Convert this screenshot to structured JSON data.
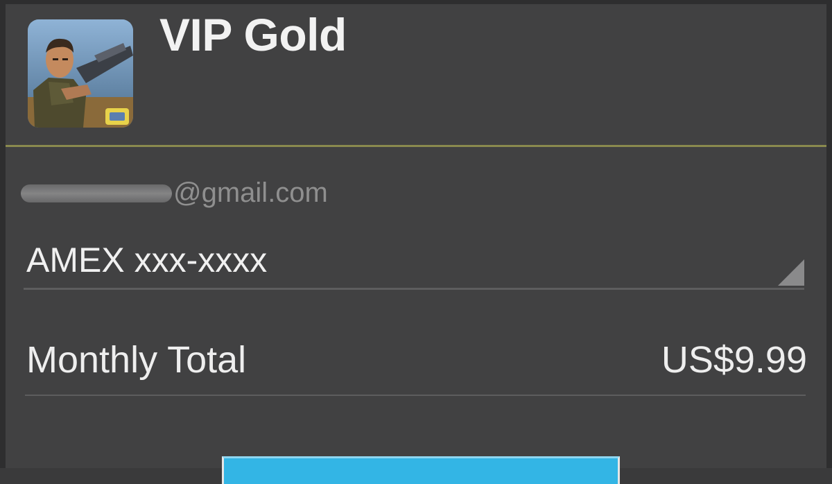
{
  "header": {
    "app_title": "VIP Gold",
    "app_icon": "game-soldier-icon"
  },
  "account": {
    "email_visible_part": "@gmail.com"
  },
  "payment": {
    "selected_method": "AMEX xxx-xxxx"
  },
  "total": {
    "label": "Monthly Total",
    "value": "US$9.99"
  },
  "colors": {
    "background": "#414142",
    "accent_divider": "#8a8a4e",
    "button": "#33b5e5"
  }
}
